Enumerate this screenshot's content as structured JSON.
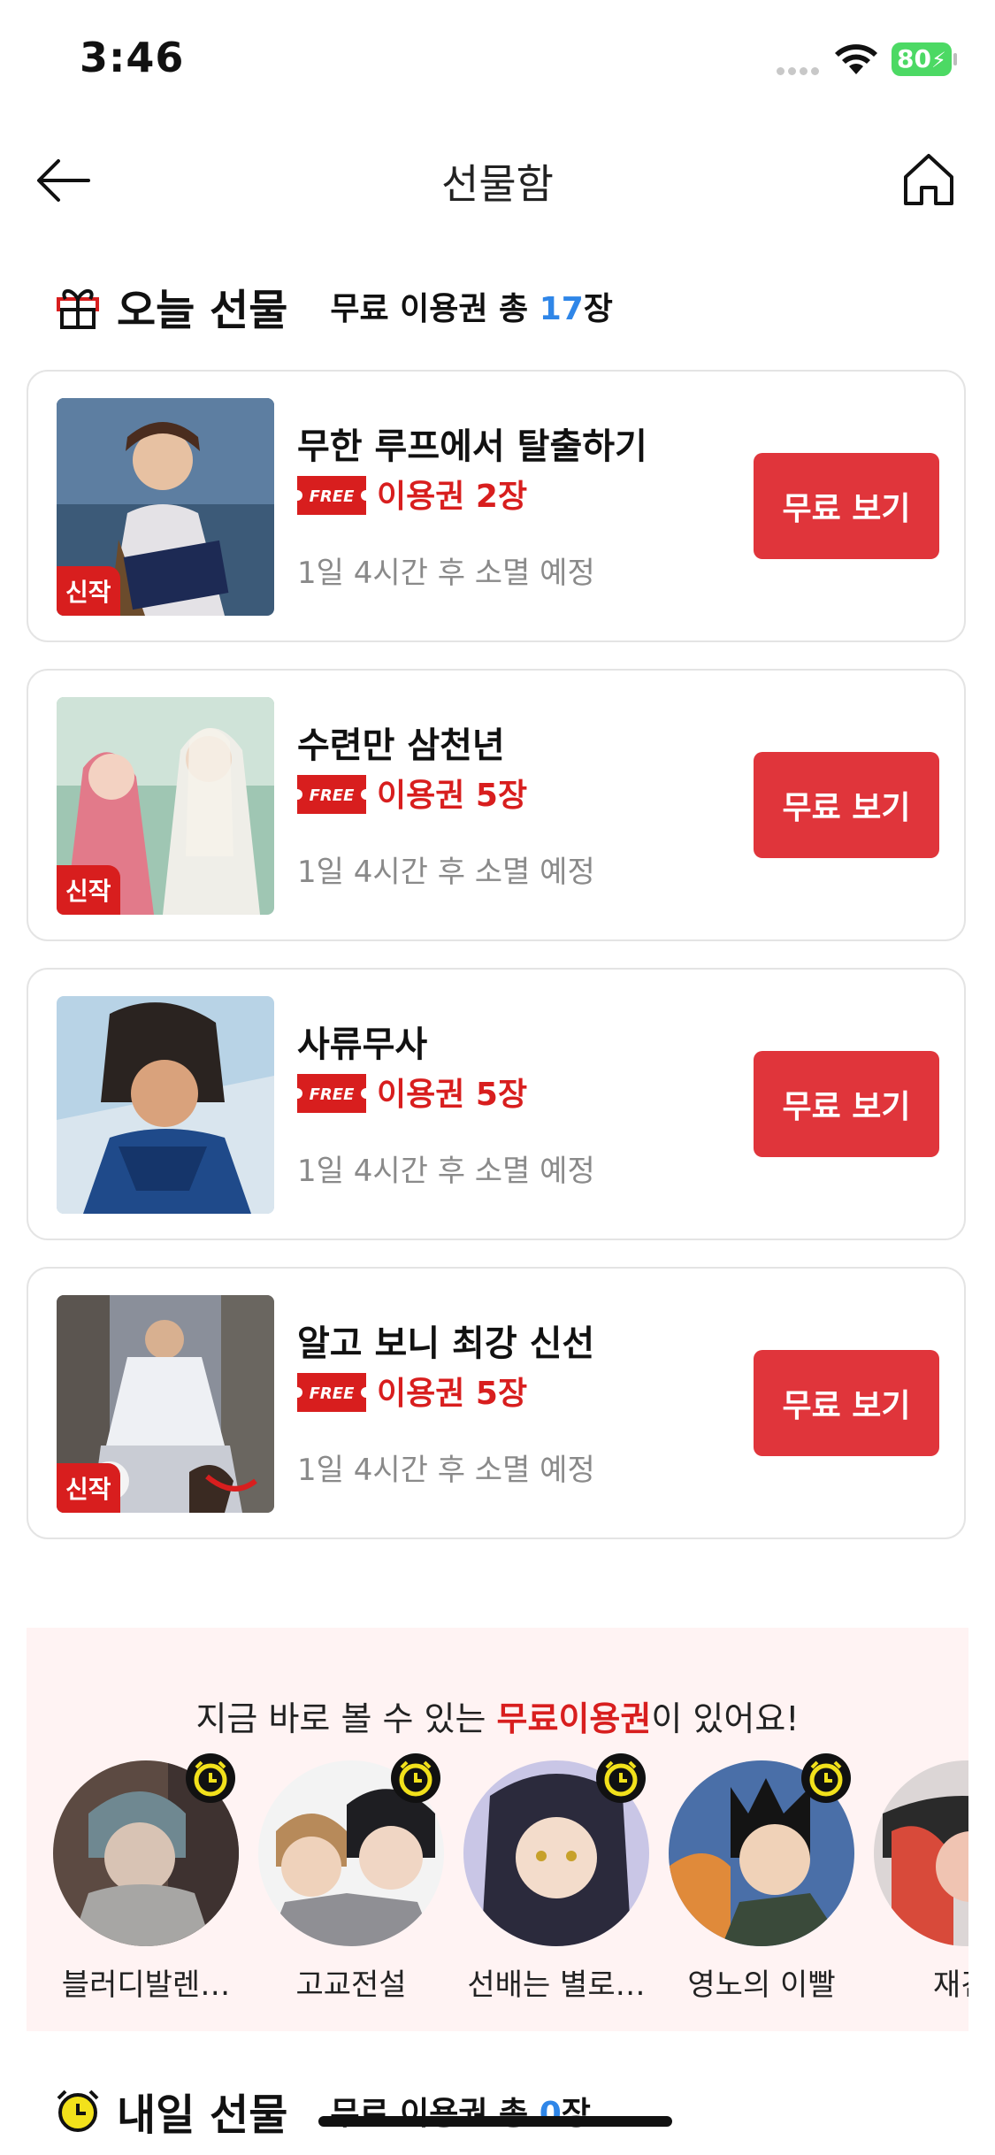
{
  "status": {
    "time": "3:46",
    "battery": "80"
  },
  "header": {
    "title": "선물함"
  },
  "today": {
    "title": "오늘 선물",
    "sub_prefix": "무료 이용권 총 ",
    "count": "17",
    "sub_suffix": "장"
  },
  "cards": [
    {
      "title": "무한 루프에서 탈출하기",
      "ticket": "이용권 2장",
      "expire": "1일 4시간 후 소멸 예정",
      "button": "무료 보기",
      "badge": "신작",
      "free": "FREE"
    },
    {
      "title": "수련만 삼천년",
      "ticket": "이용권 5장",
      "expire": "1일 4시간 후 소멸 예정",
      "button": "무료 보기",
      "badge": "신작",
      "free": "FREE"
    },
    {
      "title": "사류무사",
      "ticket": "이용권 5장",
      "expire": "1일 4시간 후 소멸 예정",
      "button": "무료 보기",
      "badge": "",
      "free": "FREE"
    },
    {
      "title": "알고 보니 최강 신선",
      "ticket": "이용권 5장",
      "expire": "1일 4시간 후 소멸 예정",
      "button": "무료 보기",
      "badge": "신작",
      "free": "FREE"
    }
  ],
  "promo": {
    "text_before": "지금 바로 볼 수 있는 ",
    "text_highlight": "무료이용권",
    "text_after": "이 있어요!",
    "items": [
      {
        "name": "블러디발렌…"
      },
      {
        "name": "고교전설"
      },
      {
        "name": "선배는 별로…"
      },
      {
        "name": "영노의 이빨"
      },
      {
        "name": "재건!"
      }
    ]
  },
  "tomorrow": {
    "title": "내일 선물",
    "sub_prefix": "무료 이용권 총 ",
    "count": "0",
    "sub_suffix": "장"
  },
  "colors": {
    "accent": "#e0353b",
    "ticket_red": "#d81e1e",
    "count_blue": "#2f86e8",
    "promo_bg": "#fff3f3",
    "clock_yellow": "#f2e11b"
  }
}
